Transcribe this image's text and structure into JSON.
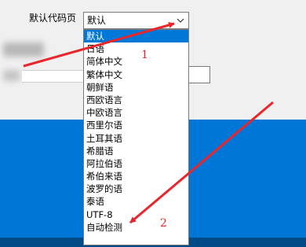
{
  "form": {
    "label": "默认代码页",
    "select_value": "默认",
    "chevron_icon": "chevron-down-icon"
  },
  "dropdown": {
    "options": [
      "默认",
      "日语",
      "简体中文",
      "繁体中文",
      "朝鲜语",
      "西欧语言",
      "中欧语言",
      "西里尔语",
      "土耳其语",
      "希腊语",
      "阿拉伯语",
      "希伯来语",
      "波罗的语",
      "泰语",
      "UTF-8",
      "自动检测"
    ],
    "selected_index": 0
  },
  "annotations": {
    "marker1": "1",
    "marker2": "2",
    "color": "#e8262b"
  },
  "colors": {
    "accent": "#0078d7",
    "band": "#0077d6",
    "dark_strip": "#004a86"
  }
}
